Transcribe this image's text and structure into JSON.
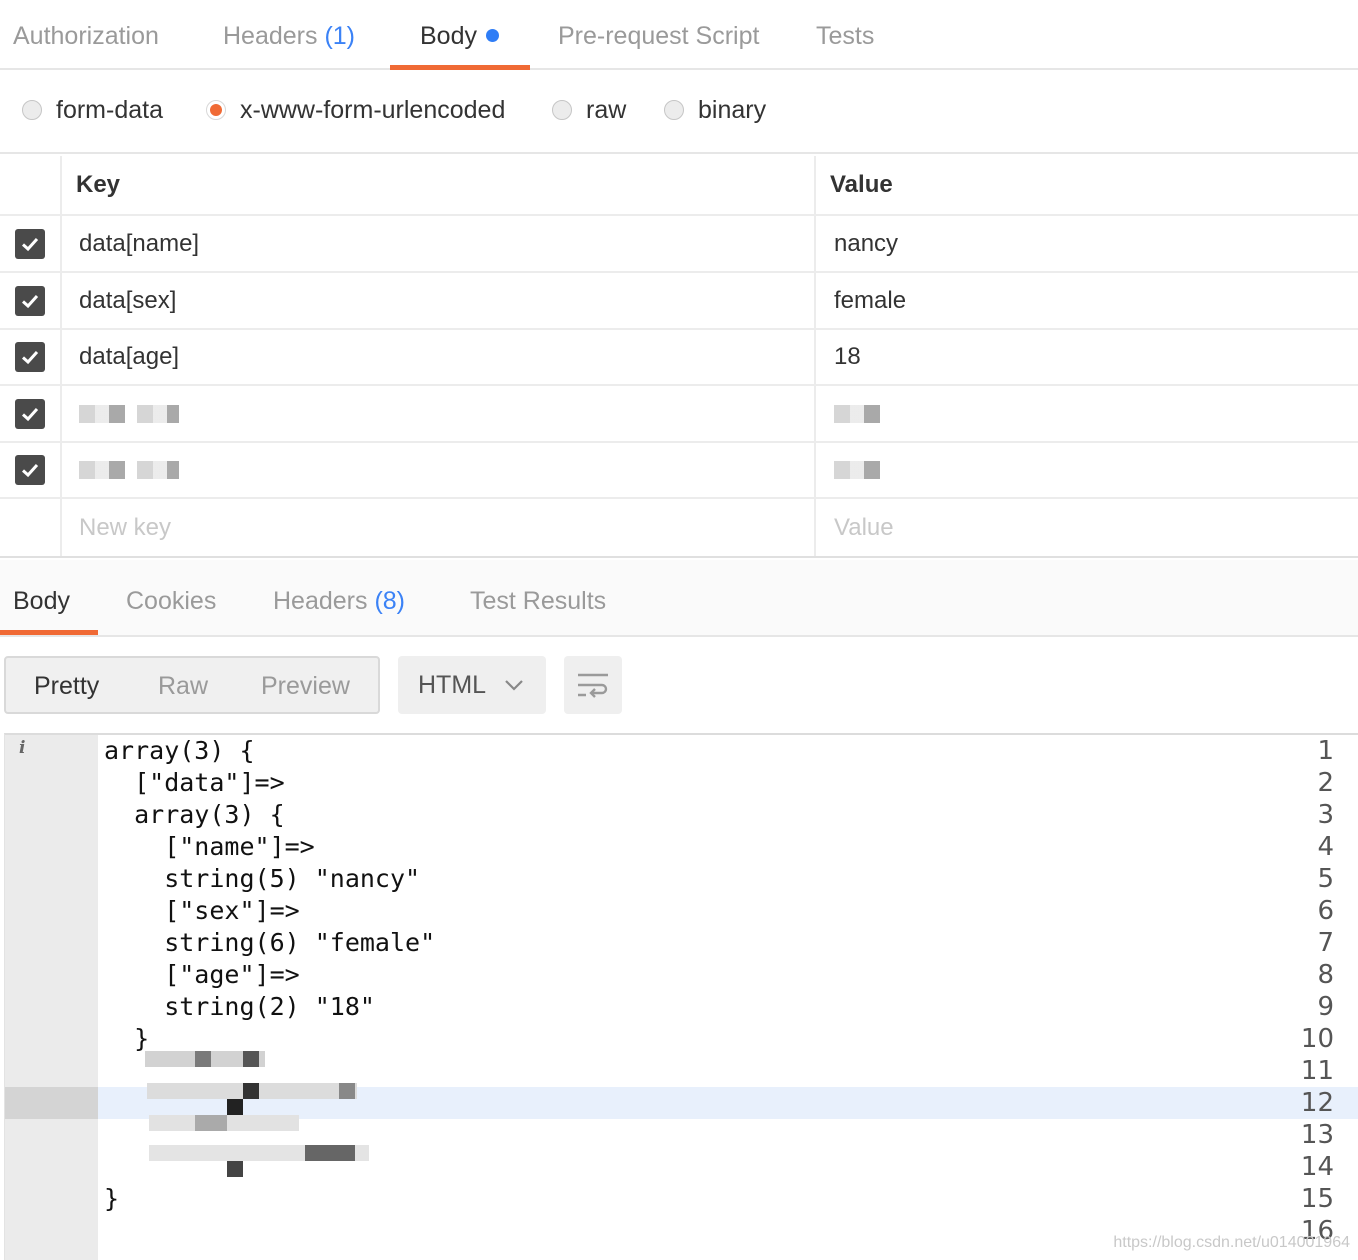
{
  "request_tabs": [
    {
      "label": "Authorization",
      "count": ""
    },
    {
      "label": "Headers",
      "count": "(1)"
    },
    {
      "label": "Body",
      "count": ""
    },
    {
      "label": "Pre-request Script",
      "count": ""
    },
    {
      "label": "Tests",
      "count": ""
    }
  ],
  "active_request_tab": "Body",
  "body_types": [
    "form-data",
    "x-www-form-urlencoded",
    "raw",
    "binary"
  ],
  "selected_body_type": "x-www-form-urlencoded",
  "table": {
    "key_header": "Key",
    "value_header": "Value",
    "rows": [
      {
        "key": "data[name]",
        "value": "nancy",
        "checked": true
      },
      {
        "key": "data[sex]",
        "value": "female",
        "checked": true
      },
      {
        "key": "data[age]",
        "value": "18",
        "checked": true
      }
    ],
    "new_key_placeholder": "New key",
    "new_value_placeholder": "Value"
  },
  "response_tabs": [
    {
      "label": "Body",
      "count": ""
    },
    {
      "label": "Cookies",
      "count": ""
    },
    {
      "label": "Headers",
      "count": "(8)"
    },
    {
      "label": "Test Results",
      "count": ""
    }
  ],
  "view_modes": [
    "Pretty",
    "Raw",
    "Preview"
  ],
  "active_view_mode": "Pretty",
  "language": "HTML",
  "code": {
    "line_numbers": [
      "1",
      "2",
      "3",
      "4",
      "5",
      "6",
      "7",
      "8",
      "9",
      "10",
      "11",
      "12",
      "13",
      "14",
      "15",
      "16"
    ],
    "lines": [
      "array(3) {",
      "  [\"data\"]=>",
      "  array(3) {",
      "    [\"name\"]=>",
      "    string(5) \"nancy\"",
      "    [\"sex\"]=>",
      "    string(6) \"female\"",
      "    [\"age\"]=>",
      "    string(2) \"18\"",
      "  }",
      "",
      "",
      "",
      "",
      "}",
      ""
    ]
  },
  "watermark": "https://blog.csdn.net/u014001964",
  "colors": {
    "accent": "#f06a35",
    "link": "#3b82f6",
    "checkbox": "#4a4a4a"
  }
}
